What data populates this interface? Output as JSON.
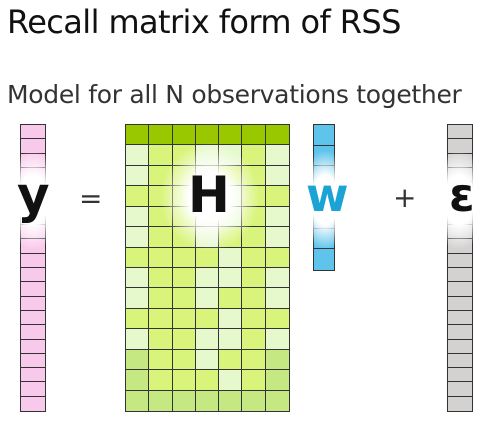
{
  "slide": {
    "title": "Recall matrix form of RSS",
    "subtitle": "Model for all N observations together"
  },
  "equation": {
    "y_symbol": "y",
    "equals_symbol": "=",
    "H_symbol": "H",
    "w_symbol": "w",
    "plus_symbol": "+",
    "epsilon_symbol": "ε"
  },
  "colors": {
    "y_vector": "#f9c9ec",
    "w_vector": "#5fc4ec",
    "w_symbol": "#1aa3d4",
    "epsilon_vector": "#d4d1d1",
    "H_green_dark": "#99c800",
    "H_green_mid": "#c6e882",
    "H_green_light": "#e6f9cc",
    "H_green_bright": "#d9f47a"
  }
}
